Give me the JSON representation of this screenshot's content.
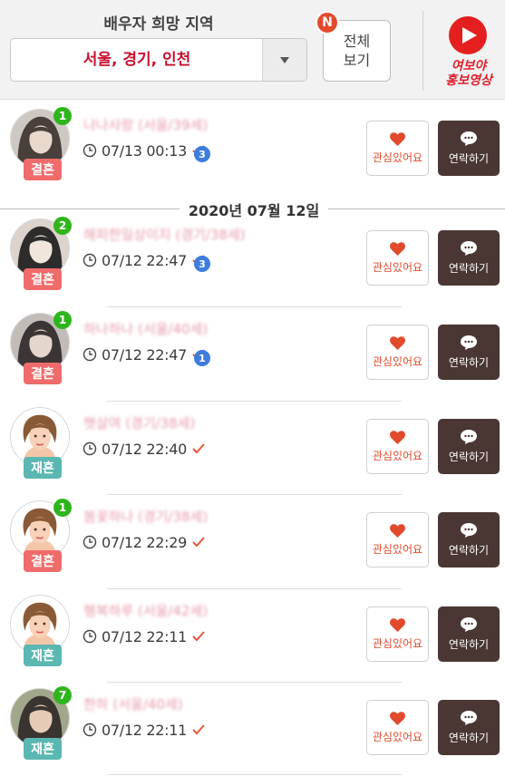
{
  "header": {
    "region_title": "배우자 희망 지역",
    "region_value": "서울, 경기, 인천",
    "view_all_line1": "전체",
    "view_all_line2": "보기",
    "new_badge": "N",
    "promo_line1": "여보야",
    "promo_line2": "홍보영상"
  },
  "date_divider": "2020년 07월 12일",
  "buttons": {
    "like_label": "관심있어요",
    "contact_label": "연락하기"
  },
  "items": [
    {
      "nickname": "나나사랑 (서울/39세)",
      "time": "07/13 00:13",
      "status": "결혼",
      "status_type": "married",
      "avatar_count": "1",
      "read_count": "3",
      "avatar": "photo-1"
    },
    {
      "nickname": "해피한일상이지 (경기/38세)",
      "time": "07/12 22:47",
      "status": "결혼",
      "status_type": "married",
      "avatar_count": "2",
      "read_count": "3",
      "avatar": "photo-2"
    },
    {
      "nickname": "하나하나 (서울/40세)",
      "time": "07/12 22:47",
      "status": "결혼",
      "status_type": "married",
      "avatar_count": "1",
      "read_count": "1",
      "avatar": "photo-3"
    },
    {
      "nickname": "햇살여 (경기/38세)",
      "time": "07/12 22:40",
      "status": "재혼",
      "status_type": "remarried",
      "avatar_count": "",
      "read_count": "",
      "avatar": "female-default"
    },
    {
      "nickname": "봄꽃하나 (경기/38세)",
      "time": "07/12 22:29",
      "status": "결혼",
      "status_type": "married",
      "avatar_count": "1",
      "read_count": "",
      "avatar": "female-default"
    },
    {
      "nickname": "행복하루 (서울/42세)",
      "time": "07/12 22:11",
      "status": "재혼",
      "status_type": "remarried",
      "avatar_count": "",
      "read_count": "",
      "avatar": "female-default"
    },
    {
      "nickname": "한하 (서울/40세)",
      "time": "07/12 22:11",
      "status": "재혼",
      "status_type": "remarried",
      "avatar_count": "7",
      "read_count": "",
      "avatar": "photo-4"
    }
  ],
  "colors": {
    "married_tag": "#f06b6b",
    "remarried_tag": "#5bb7b1",
    "accent_red": "#e24a2c",
    "contact_button": "#4a3733",
    "avatar_badge": "#2fb51c",
    "read_badge": "#3d7ddc"
  },
  "icons": {
    "dropdown": "caret-down-icon",
    "promo": "youtube-play-icon",
    "time": "clock-icon",
    "read": "check-icon",
    "like": "heart-icon",
    "contact": "chat-bubble-icon"
  }
}
